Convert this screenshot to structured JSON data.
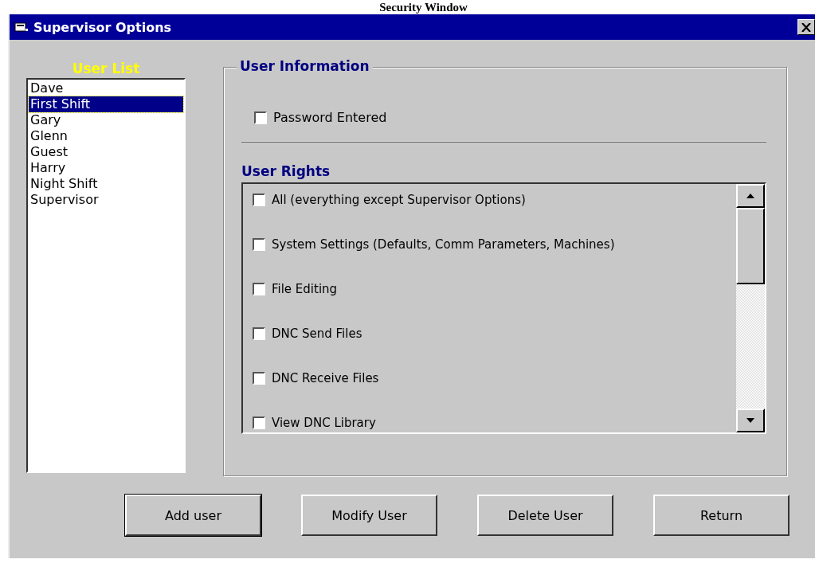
{
  "caption": "Security Window",
  "window": {
    "title": "Supervisor Options"
  },
  "user_list": {
    "label": "User List",
    "items": [
      {
        "name": "Dave",
        "selected": false
      },
      {
        "name": "First Shift",
        "selected": true
      },
      {
        "name": "Gary",
        "selected": false
      },
      {
        "name": "Glenn",
        "selected": false
      },
      {
        "name": "Guest",
        "selected": false
      },
      {
        "name": "Harry",
        "selected": false
      },
      {
        "name": "Night Shift",
        "selected": false
      },
      {
        "name": "Supervisor",
        "selected": false
      }
    ]
  },
  "user_information": {
    "title": "User Information",
    "password_entered": {
      "label": "Password Entered",
      "checked": false
    }
  },
  "user_rights": {
    "title": "User Rights",
    "items": [
      {
        "label": "All (everything except Supervisor Options)",
        "checked": false
      },
      {
        "label": "System Settings (Defaults, Comm Parameters, Machines)",
        "checked": false
      },
      {
        "label": "File Editing",
        "checked": false
      },
      {
        "label": "DNC Send Files",
        "checked": false
      },
      {
        "label": "DNC Receive Files",
        "checked": false
      },
      {
        "label": "View DNC Library",
        "checked": false
      }
    ]
  },
  "buttons": [
    {
      "label": "Add user",
      "default": true
    },
    {
      "label": "Modify User",
      "default": false
    },
    {
      "label": "Delete User",
      "default": false
    },
    {
      "label": "Return",
      "default": false
    }
  ]
}
